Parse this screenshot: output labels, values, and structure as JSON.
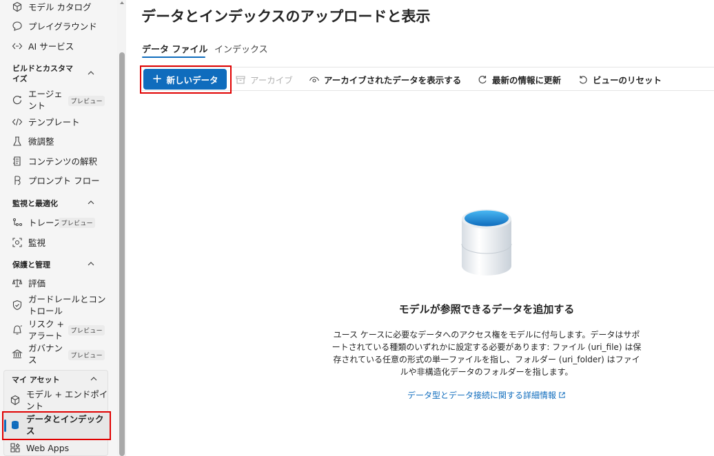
{
  "sidebar": {
    "items_top": [
      {
        "label": "モデル カタログ",
        "icon": "cube-catalog-icon"
      },
      {
        "label": "プレイグラウンド",
        "icon": "chat-bubble-icon"
      },
      {
        "label": "AI サービス",
        "icon": "diamond-link-icon"
      }
    ],
    "build": {
      "heading": "ビルドとカスタマイズ",
      "items": [
        {
          "label": "エージェント",
          "badge": "プレビュー",
          "icon": "agent-icon"
        },
        {
          "label": "テンプレート",
          "icon": "code-icon"
        },
        {
          "label": "微調整",
          "icon": "flask-icon"
        },
        {
          "label": "コンテンツの解釈",
          "icon": "document-scan-icon"
        },
        {
          "label": "プロンプト フロー",
          "icon": "flow-icon"
        }
      ]
    },
    "monitor": {
      "heading": "監視と最適化",
      "items": [
        {
          "label": "トレース",
          "badge": "プレビュー",
          "icon": "trace-icon"
        },
        {
          "label": "監視",
          "icon": "monitor-camera-icon"
        }
      ]
    },
    "protect": {
      "heading": "保護と管理",
      "items": [
        {
          "label": "評価",
          "icon": "scale-icon"
        },
        {
          "label": "ガードレールとコントロール",
          "icon": "shield-icon"
        },
        {
          "label": "リスク + アラート",
          "badge": "プレビュー",
          "icon": "alert-icon"
        },
        {
          "label": "ガバナンス",
          "badge": "プレビュー",
          "icon": "bank-icon"
        }
      ]
    },
    "assets": {
      "heading": "マイ アセット",
      "items": [
        {
          "label": "モデル + エンドポイント",
          "icon": "cube-icon"
        },
        {
          "label": "データとインデックス",
          "icon": "database-icon"
        },
        {
          "label": "Web Apps",
          "icon": "apps-icon"
        }
      ]
    }
  },
  "main": {
    "title": "データとインデックスのアップロードと表示",
    "tabs": [
      {
        "label": "データ ファイル",
        "selected": true
      },
      {
        "label": "インデックス",
        "selected": false
      }
    ],
    "toolbar": {
      "new_data": "新しいデータ",
      "archive": "アーカイブ",
      "show_archived": "アーカイブされたデータを表示する",
      "refresh": "最新の情報に更新",
      "reset_view": "ビューのリセット"
    },
    "empty_state": {
      "title": "モデルが参照できるデータを追加する",
      "description": "ユース ケースに必要なデータへのアクセス権をモデルに付与します。データはサポートされている種類のいずれかに設定する必要があります: ファイル (uri_file) は保存されている任意の形式の単一ファイルを指し、フォルダー (uri_folder) はファイルや非構造化データのフォルダーを指します。",
      "link": "データ型とデータ接続に関する詳細情報"
    }
  },
  "colors": {
    "accent": "#0f6cbd",
    "highlight_border": "#e00000",
    "disabled_text": "#b0b0b0"
  }
}
